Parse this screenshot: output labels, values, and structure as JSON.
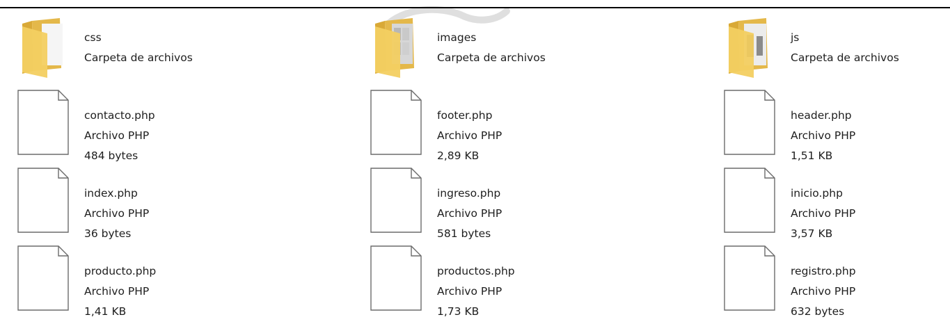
{
  "colors": {
    "folder_front": "#f3cf61",
    "folder_back": "#d9a937",
    "folder_paper": "#f5f5f5",
    "file_border": "#6b6b6b",
    "file_fill": "#ffffff",
    "text": "#1e1e1e",
    "rule": "#000000"
  },
  "items": [
    {
      "name": "css",
      "type": "Carpeta de archivos",
      "size": "",
      "kind": "folder",
      "icon": "folder-icon"
    },
    {
      "name": "images",
      "type": "Carpeta de archivos",
      "size": "",
      "kind": "folder",
      "icon": "folder-images-icon"
    },
    {
      "name": "js",
      "type": "Carpeta de archivos",
      "size": "",
      "kind": "folder",
      "icon": "folder-documents-icon"
    },
    {
      "name": "contacto.php",
      "type": "Archivo PHP",
      "size": "484 bytes",
      "kind": "file",
      "icon": "blank-file-icon"
    },
    {
      "name": "footer.php",
      "type": "Archivo PHP",
      "size": "2,89 KB",
      "kind": "file",
      "icon": "blank-file-icon"
    },
    {
      "name": "header.php",
      "type": "Archivo PHP",
      "size": "1,51 KB",
      "kind": "file",
      "icon": "blank-file-icon"
    },
    {
      "name": "index.php",
      "type": "Archivo PHP",
      "size": "36 bytes",
      "kind": "file",
      "icon": "blank-file-icon"
    },
    {
      "name": "ingreso.php",
      "type": "Archivo PHP",
      "size": "581 bytes",
      "kind": "file",
      "icon": "blank-file-icon"
    },
    {
      "name": "inicio.php",
      "type": "Archivo PHP",
      "size": "3,57 KB",
      "kind": "file",
      "icon": "blank-file-icon"
    },
    {
      "name": "producto.php",
      "type": "Archivo PHP",
      "size": "1,41 KB",
      "kind": "file",
      "icon": "blank-file-icon"
    },
    {
      "name": "productos.php",
      "type": "Archivo PHP",
      "size": "1,73 KB",
      "kind": "file",
      "icon": "blank-file-icon"
    },
    {
      "name": "registro.php",
      "type": "Archivo PHP",
      "size": "632 bytes",
      "kind": "file",
      "icon": "blank-file-icon"
    }
  ]
}
